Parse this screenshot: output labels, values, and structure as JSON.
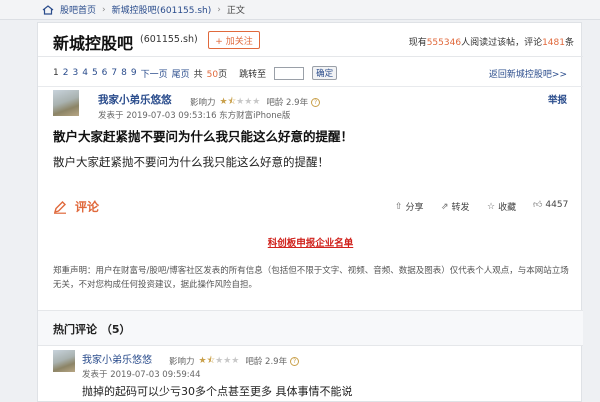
{
  "breadcrumb": {
    "home": "股吧首页",
    "bar": "新城控股吧(601155.sh)",
    "current": "正文"
  },
  "header": {
    "bar_name": "新城控股吧",
    "bar_code": "(601155.sh)",
    "follow_label": "+ 加关注",
    "stats_prefix": "现有",
    "readers": "555346",
    "stats_mid": "人阅读过该帖，评论",
    "comments": "1481",
    "stats_suffix": "条"
  },
  "pager": {
    "pages": [
      "1",
      "2",
      "3",
      "4",
      "5",
      "6",
      "7",
      "8",
      "9"
    ],
    "next": "下一页",
    "last": "尾页",
    "total_prefix": "共",
    "total_pages": "50",
    "total_suffix": "页",
    "jump_label": "跳转至",
    "page_input_value": "",
    "ok_label": "确定",
    "back_link": "返回新城控股吧>>"
  },
  "post": {
    "author": "我家小弟乐悠悠",
    "influence_label": "影响力",
    "rating": 1.5,
    "rating_max": 5,
    "age": "吧龄 2.9年",
    "report": "举报",
    "posted": "发表于 2019-07-03 09:53:16 东方财富iPhone版",
    "title": "散户大家赶紧抛不要问为什么我只能这么好意的提醒！",
    "body": "散户大家赶紧抛不要问为什么我只能这么好意的提醒！",
    "comment_label": "评论",
    "share": "分享",
    "repost": "转发",
    "favorite": "收藏",
    "likes": "4457"
  },
  "ad_link": "科创板申报企业名单",
  "disclaimer": "郑重声明：用户在财富号/股吧/博客社区发表的所有信息（包括但不限于文字、视频、音频、数据及图表）仅代表个人观点，与本网站立场无关，不对您构成任何投资建议，据此操作风险自担。",
  "hot_comments": {
    "title": "热门评论 （5）",
    "items": [
      {
        "author": "我家小弟乐悠悠",
        "influence_label": "影响力",
        "rating": 1.5,
        "age": "吧龄 2.9年",
        "posted": "发表于 2019-07-03 09:59:44",
        "text": "抛掉的起码可以少亏30多个点甚至更多 具体事情不能说"
      }
    ]
  },
  "colors": {
    "link_blue": "#2a4c8c",
    "accent_orange": "#e0693c",
    "ad_red": "#d0221c",
    "star_gold": "#c9a04a"
  }
}
